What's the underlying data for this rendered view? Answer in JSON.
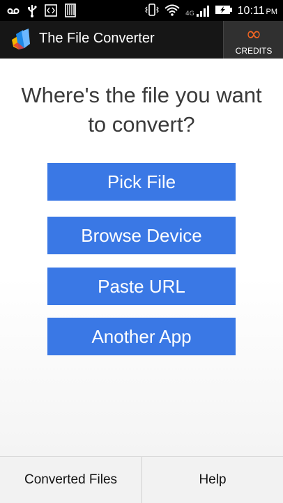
{
  "status_bar": {
    "left_icons": [
      "voicemail-icon",
      "usb-icon",
      "code-icon",
      "sd-card-icon"
    ],
    "right_icons": [
      "vibrate-icon",
      "wifi-icon",
      "signal-4g-icon",
      "battery-charging-icon"
    ],
    "network_label": "4G",
    "time": "10:11",
    "ampm": "PM"
  },
  "action_bar": {
    "title": "The File Converter",
    "logo_icon": "app-logo-icon",
    "credits_symbol": "∞",
    "credits_label": "CREDITS",
    "accent_color": "#f26522"
  },
  "main": {
    "prompt": "Where's the file you want to convert?",
    "buttons": [
      {
        "label": "Pick File"
      },
      {
        "label": "Browse Device"
      },
      {
        "label": "Paste URL"
      },
      {
        "label": "Another App"
      }
    ],
    "button_color": "#3a78e5"
  },
  "bottom_bar": {
    "left": "Converted Files",
    "right": "Help"
  }
}
